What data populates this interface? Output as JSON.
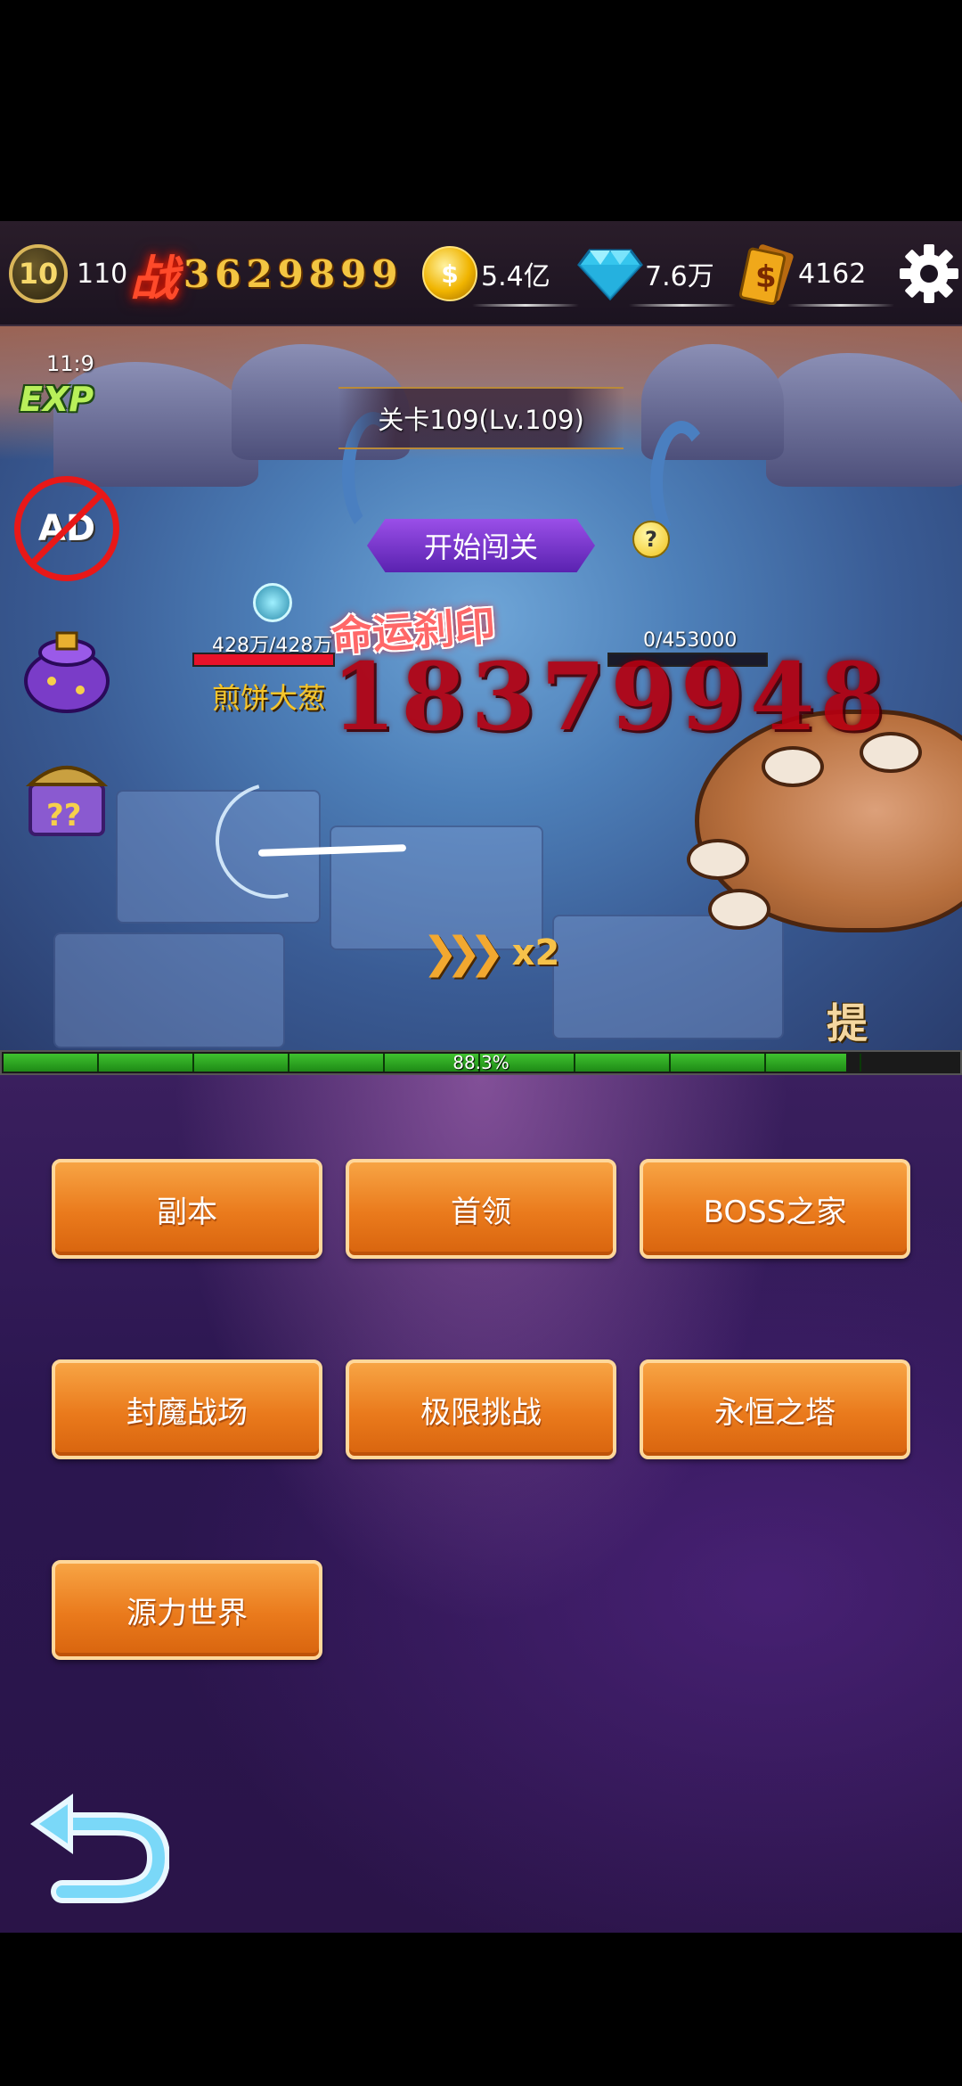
{
  "topbar": {
    "level": "10",
    "level_points": "110",
    "power_glyph": "战",
    "power": "3629899",
    "gold": "5.4亿",
    "gems": "7.6万",
    "cash": "4162",
    "colors": {
      "power": "#f3c542",
      "gold": "#f0b400",
      "gem": "#3fd0f0"
    }
  },
  "battle": {
    "exp_timer": "11:9",
    "exp_label": "EXP",
    "ad_label": "AD",
    "stage_title": "关卡109(Lv.109)",
    "start_button": "开始闯关",
    "tip_label": "?",
    "player_hp": "428万/428万",
    "player_hp_fraction": 1.0,
    "player_name": "煎饼大葱",
    "enemy_hp": "0/453000",
    "enemy_hp_fraction": 0.0,
    "skill_name": "命运刹印",
    "damage": "18379948",
    "speed_label": "x2",
    "hint_button": "提示"
  },
  "progress": {
    "label": "88.3%",
    "value": 0.883,
    "segments": 9
  },
  "menu": {
    "buttons": [
      {
        "label": "副本"
      },
      {
        "label": "首领"
      },
      {
        "label": "BOSS之家"
      },
      {
        "label": "封魔战场"
      },
      {
        "label": "极限挑战"
      },
      {
        "label": "永恒之塔"
      },
      {
        "label": "源力世界"
      }
    ]
  }
}
